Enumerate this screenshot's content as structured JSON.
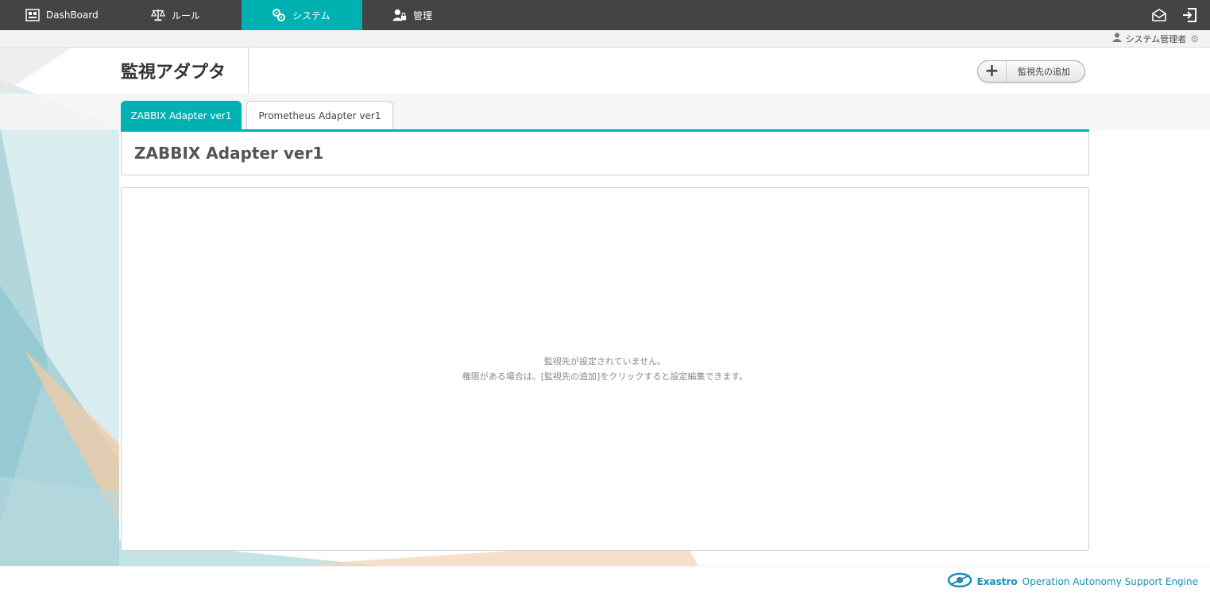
{
  "nav": {
    "items": [
      {
        "label": "DashBoard",
        "icon": "dashboard-icon"
      },
      {
        "label": "ルール",
        "icon": "scale-icon"
      },
      {
        "label": "システム",
        "icon": "gears-icon"
      },
      {
        "label": "管理",
        "icon": "admin-user-icon"
      }
    ],
    "active_index": 2,
    "accent_color": "#00b1b1",
    "bar_color": "#444444"
  },
  "userbar": {
    "user_name": "システム管理者"
  },
  "page": {
    "title": "監視アダプタ",
    "add_button_label": "監視先の追加"
  },
  "tabs": [
    {
      "label": "ZABBIX Adapter ver1",
      "active": true
    },
    {
      "label": "Prometheus Adapter ver1",
      "active": false
    }
  ],
  "section": {
    "heading": "ZABBIX Adapter ver1"
  },
  "empty_state": {
    "line1": "監視先が設定されていません。",
    "line2": "権限がある場合は、[監視先の追加]をクリックすると設定編集できます。"
  },
  "footer": {
    "brand": "Exastro",
    "tagline": "Operation Autonomy Support Engine"
  }
}
